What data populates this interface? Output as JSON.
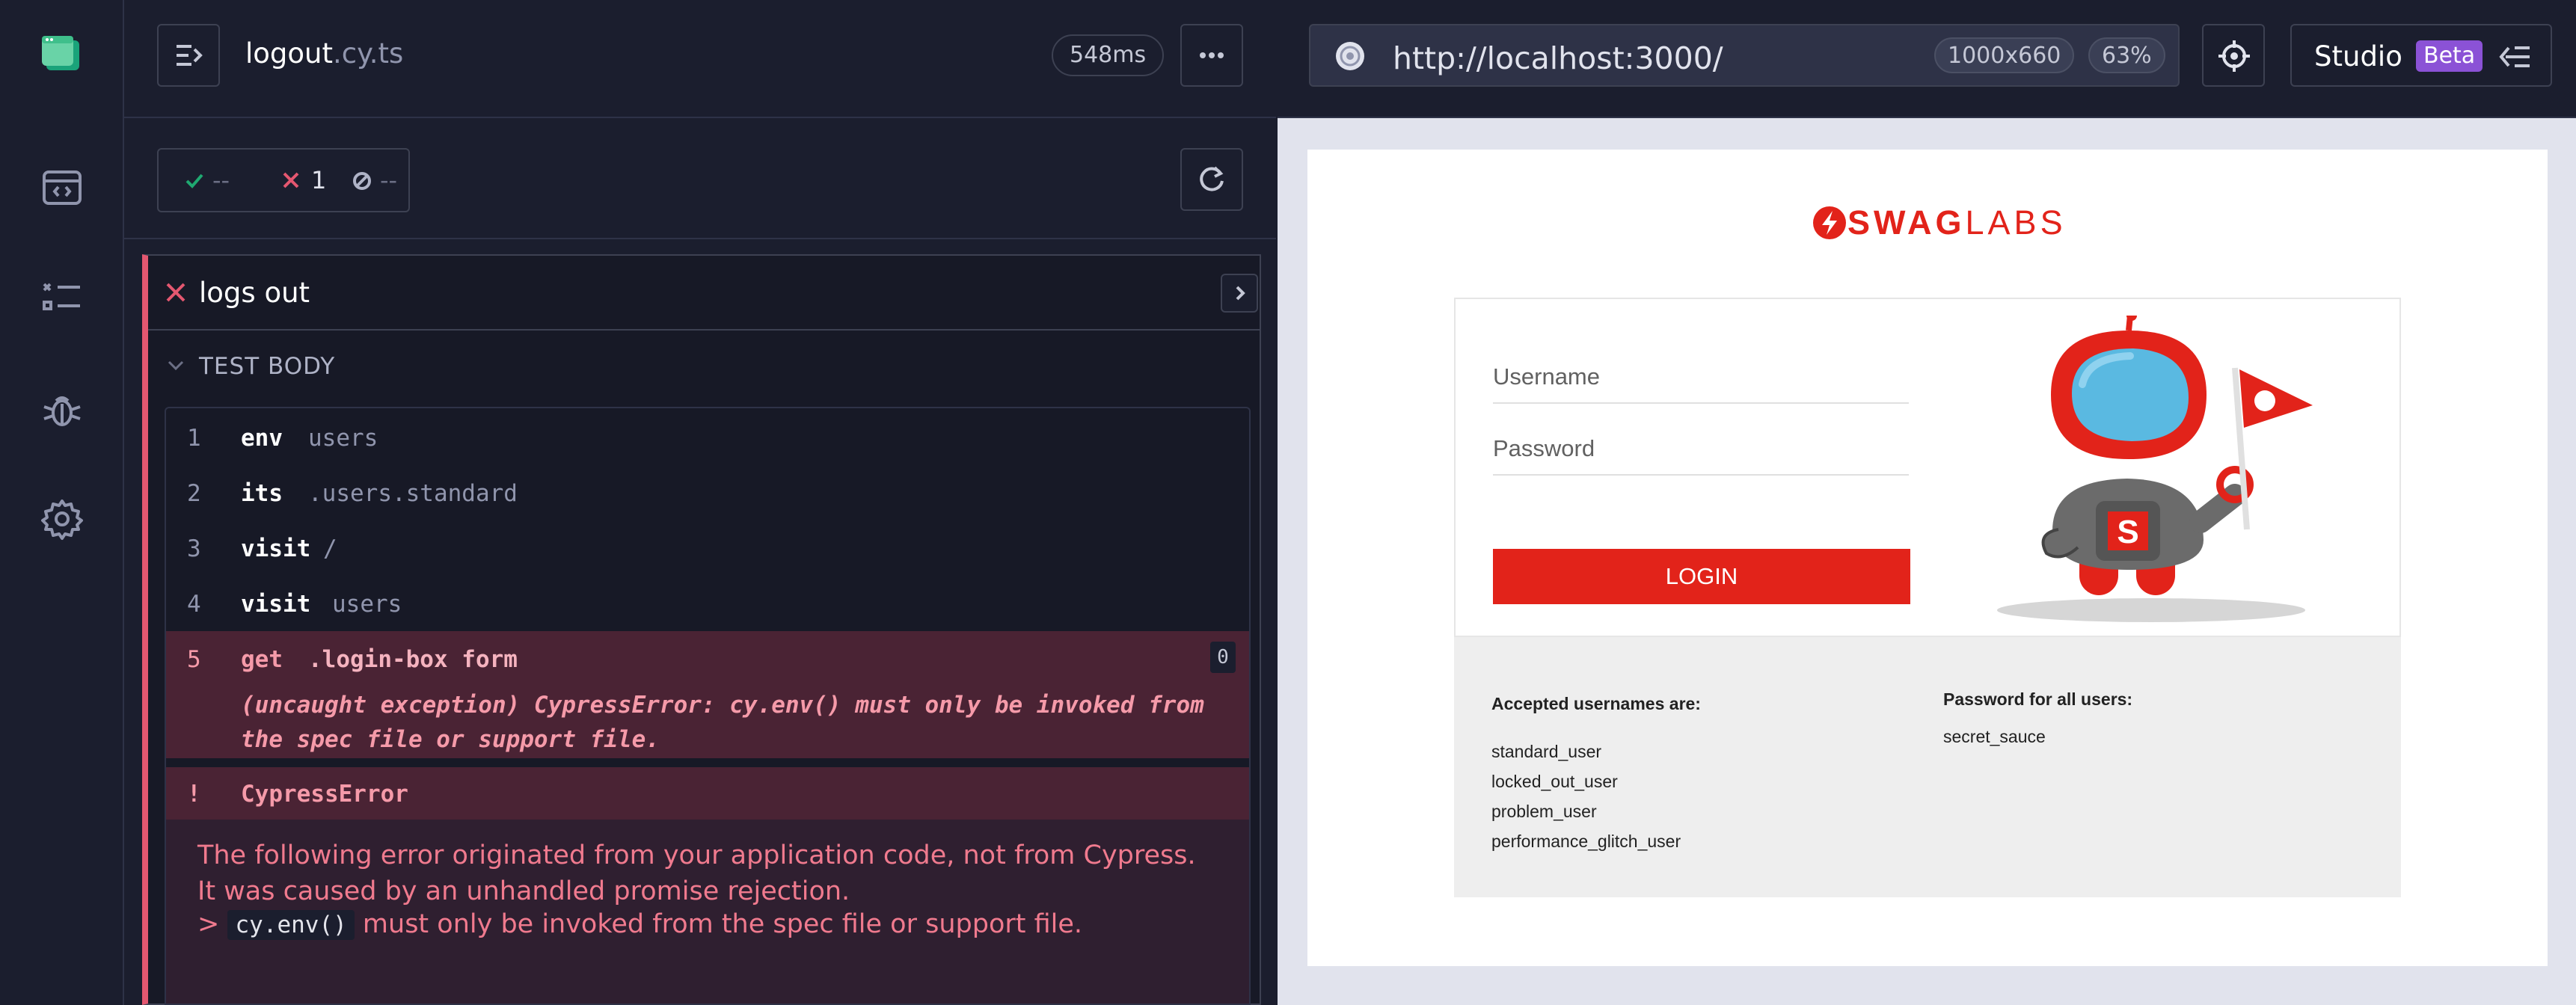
{
  "reporter": {
    "spec_name": "logout",
    "spec_ext": ".cy.ts",
    "duration": "548ms",
    "stats": {
      "passed": "--",
      "failed": "1",
      "pending": "--"
    }
  },
  "test": {
    "title": "logs out",
    "section_label": "TEST BODY",
    "commands": [
      {
        "num": "1",
        "name": "env",
        "arg": "users"
      },
      {
        "num": "2",
        "name": "its",
        "arg": ".users.standard"
      },
      {
        "num": "3",
        "name": "visit",
        "arg": "/"
      },
      {
        "num": "4",
        "name": "visit",
        "arg": "users"
      },
      {
        "num": "5",
        "name": "get",
        "arg": ".login-box form",
        "count": "0"
      }
    ],
    "command_error_line1": "(uncaught exception)  CypressError: cy.env() must only be invoked from",
    "command_error_line2": "the spec file or support file.",
    "error": {
      "bang": "!",
      "name": "CypressError",
      "description": "The following error originated from your application code, not from Cypress. It was caused by an unhandled promise rejection.",
      "prompt": ">",
      "code": "cy.env()",
      "message": "must only be invoked from the spec file or support file."
    }
  },
  "aut": {
    "url": "http://localhost:3000/",
    "viewport_size": "1000x660",
    "zoom": "63%",
    "studio_label": "Studio",
    "beta_label": "Beta"
  },
  "app": {
    "logo_bold": "SWAG",
    "logo_light": "LABS",
    "username_placeholder": "Username",
    "password_placeholder": "Password",
    "login_label": "LOGIN",
    "accepted_heading": "Accepted usernames are:",
    "usernames": [
      "standard_user",
      "locked_out_user",
      "problem_user",
      "performance_glitch_user"
    ],
    "password_heading": "Password for all users:",
    "password_value": "secret_sauce"
  },
  "colors": {
    "background": "#1b1e2e",
    "error_accent": "#e45770",
    "swag_red": "#e2231a",
    "beta_purple": "#8b52d6",
    "pass_green": "#1fa971"
  },
  "icons": [
    "cypress-logo-icon",
    "specs-icon",
    "runs-icon",
    "debug-icon",
    "settings-icon",
    "sidebar-toggle-icon",
    "more-icon",
    "refresh-icon",
    "check-icon",
    "x-icon",
    "pending-icon",
    "chevron-right-icon",
    "chevron-down-icon",
    "browser-icon",
    "selector-playground-icon",
    "studio-collapse-icon"
  ]
}
